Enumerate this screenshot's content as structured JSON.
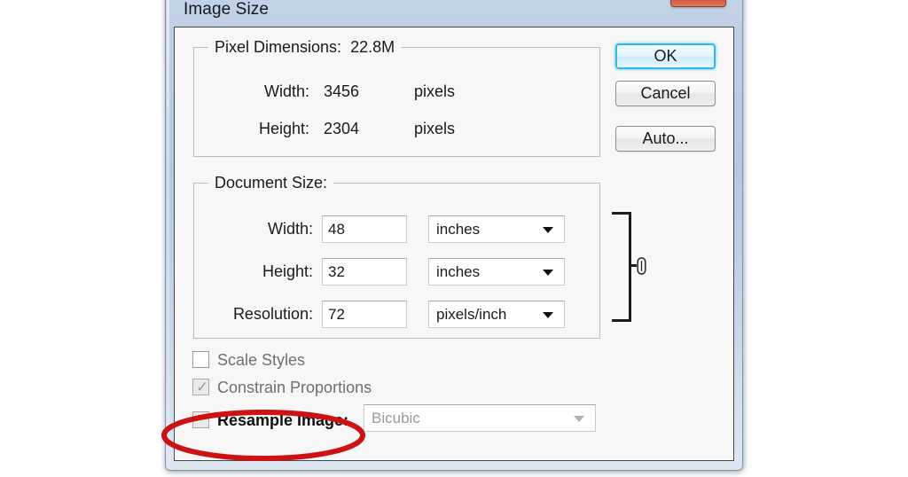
{
  "window": {
    "title": "Image Size",
    "close_icon": "close-icon",
    "close_glyph": "✕"
  },
  "pixel_dimensions": {
    "legend": "Pixel Dimensions:",
    "size_value": "22.8M",
    "rows": [
      {
        "label": "Width:",
        "value": "3456",
        "unit": "pixels"
      },
      {
        "label": "Height:",
        "value": "2304",
        "unit": "pixels"
      }
    ]
  },
  "document_size": {
    "legend": "Document Size:",
    "rows": [
      {
        "label": "Width:",
        "value": "48",
        "unit": "inches"
      },
      {
        "label": "Height:",
        "value": "32",
        "unit": "inches"
      },
      {
        "label": "Resolution:",
        "value": "72",
        "unit": "pixels/inch"
      }
    ],
    "link_icon": "chain-link-icon"
  },
  "options": {
    "scale_styles": {
      "label": "Scale Styles",
      "checked": false,
      "enabled": false
    },
    "constrain_proportions": {
      "label": "Constrain Proportions",
      "checked": true,
      "enabled": false,
      "tick": "✓"
    },
    "resample_image": {
      "label": "Resample Image:",
      "checked": false,
      "enabled": true
    },
    "resample_method": {
      "value": "Bicubic",
      "enabled": false
    }
  },
  "buttons": {
    "ok": "OK",
    "cancel": "Cancel",
    "auto": "Auto..."
  },
  "annotation": {
    "type": "ellipse-highlight",
    "target": "resample-image-checkbox",
    "color": "#cc1212"
  },
  "colors": {
    "titlebar_top": "#c3d3e6",
    "titlebar_bottom": "#dde7f1",
    "dialog_body": "#f7f7f7",
    "close_button": "#d8412c",
    "default_button_border": "#2eb8ee",
    "annotation_red": "#cc1212",
    "disabled_text": "#6f6f6f"
  }
}
